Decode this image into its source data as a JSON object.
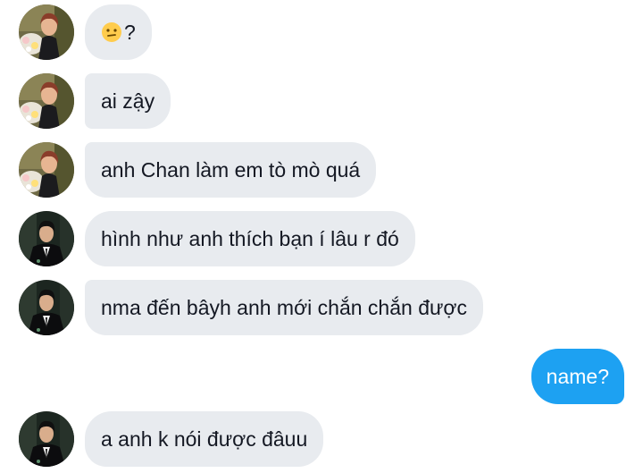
{
  "conversation": {
    "messages": [
      {
        "sender": "contact-a",
        "text": "?",
        "emoji": "confused-face-icon"
      },
      {
        "sender": "contact-a",
        "text": "ai zậy"
      },
      {
        "sender": "contact-a",
        "text": "anh Chan làm em tò mò quá"
      },
      {
        "sender": "contact-b",
        "text": "hình như anh thích bạn í lâu r đó"
      },
      {
        "sender": "contact-b",
        "text": "nma đến bâyh anh mới chắn chắn được"
      },
      {
        "sender": "me",
        "text": "name?"
      },
      {
        "sender": "contact-b",
        "text": "a anh k nói được đâuu"
      }
    ]
  },
  "colors": {
    "received_bubble": "#e8ebef",
    "sent_bubble": "#1da1f2",
    "text_dark": "#141823",
    "text_light": "#ffffff"
  }
}
